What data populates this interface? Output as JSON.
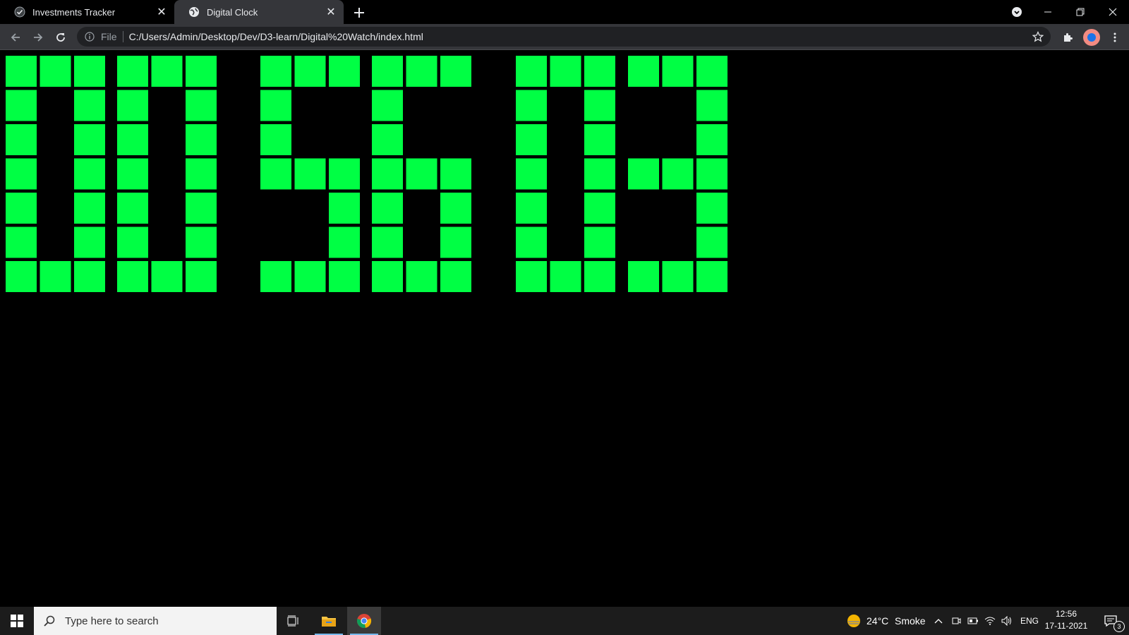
{
  "browser": {
    "tabs": [
      {
        "title": "Investments Tracker",
        "favicon": "check-circle-icon",
        "active": false
      },
      {
        "title": "Digital Clock",
        "favicon": "globe-icon",
        "active": true
      }
    ],
    "address": {
      "scheme_label": "File",
      "url": "C:/Users/Admin/Desktop/Dev/D3-learn/Digital%20Watch/index.html"
    }
  },
  "clock": {
    "time_digits": "005603",
    "on_color": "#00ff44",
    "digit_groups": [
      "00",
      "56",
      "03"
    ]
  },
  "taskbar": {
    "search_placeholder": "Type here to search",
    "weather_temp": "24°C",
    "weather_text": "Smoke",
    "language": "ENG",
    "time": "12:56",
    "date": "17-11-2021",
    "notification_count": "3"
  }
}
